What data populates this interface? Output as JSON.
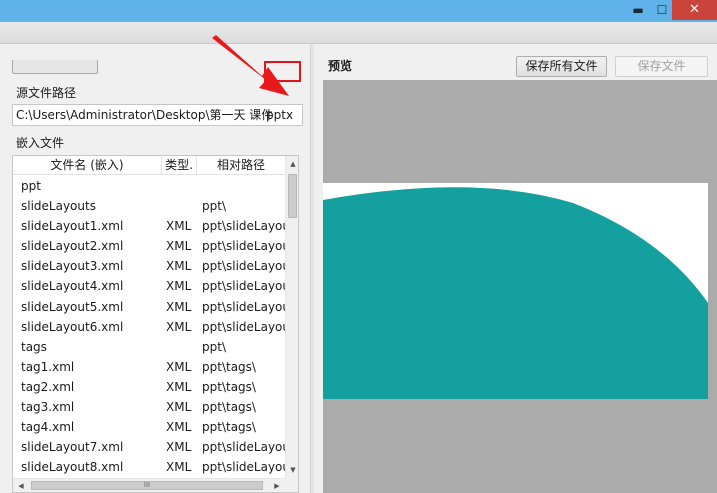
{
  "window": {
    "minimize_glyph": "▬",
    "maximize_glyph": "☐",
    "close_glyph": "✕"
  },
  "left": {
    "source_path_label": "源文件路径",
    "source_path_value": "C:\\Users\\Administrator\\Desktop\\第一天 课件",
    "source_path_ext": "pptx",
    "embedded_label": "嵌入文件",
    "columns": [
      "文件名 (嵌入)",
      "类型.",
      "相对路径"
    ],
    "rows": [
      {
        "name": "ppt",
        "type": "",
        "path": ""
      },
      {
        "name": "slideLayouts",
        "type": "",
        "path": "ppt\\"
      },
      {
        "name": "slideLayout1.xml",
        "type": "XML",
        "path": "ppt\\slideLayouts\\"
      },
      {
        "name": "slideLayout2.xml",
        "type": "XML",
        "path": "ppt\\slideLayouts\\"
      },
      {
        "name": "slideLayout3.xml",
        "type": "XML",
        "path": "ppt\\slideLayouts\\"
      },
      {
        "name": "slideLayout4.xml",
        "type": "XML",
        "path": "ppt\\slideLayouts\\"
      },
      {
        "name": "slideLayout5.xml",
        "type": "XML",
        "path": "ppt\\slideLayouts\\"
      },
      {
        "name": "slideLayout6.xml",
        "type": "XML",
        "path": "ppt\\slideLayouts\\"
      },
      {
        "name": "tags",
        "type": "",
        "path": "ppt\\"
      },
      {
        "name": "tag1.xml",
        "type": "XML",
        "path": "ppt\\tags\\"
      },
      {
        "name": "tag2.xml",
        "type": "XML",
        "path": "ppt\\tags\\"
      },
      {
        "name": "tag3.xml",
        "type": "XML",
        "path": "ppt\\tags\\"
      },
      {
        "name": "tag4.xml",
        "type": "XML",
        "path": "ppt\\tags\\"
      },
      {
        "name": "slideLayout7.xml",
        "type": "XML",
        "path": "ppt\\slideLayouts\\"
      },
      {
        "name": "slideLayout8.xml",
        "type": "XML",
        "path": "ppt\\slideLayouts\\"
      }
    ],
    "hscroll_grip": "III"
  },
  "right": {
    "preview_label": "预览",
    "save_all_button": "保存所有文件",
    "save_button": "保存文件"
  },
  "colors": {
    "titlebar": "#5fb3ea",
    "close_button": "#c9453b",
    "highlight_box": "#e0151a",
    "annotation_arrow": "#e8191c",
    "slide_teal": "#13a09f",
    "preview_background": "#ababab"
  }
}
